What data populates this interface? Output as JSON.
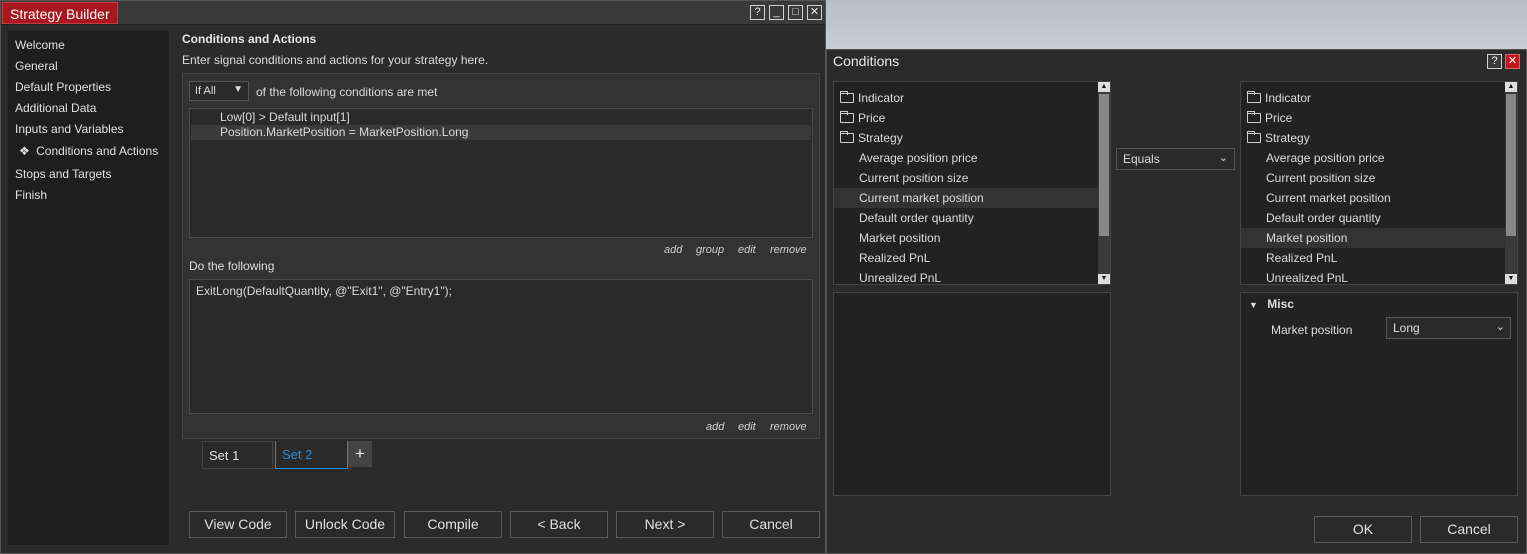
{
  "strategy_builder": {
    "title": "Strategy Builder",
    "window_buttons": [
      "?",
      "_",
      "□",
      "✕"
    ],
    "nav": [
      {
        "label": "Welcome",
        "active": false
      },
      {
        "label": "General",
        "active": false
      },
      {
        "label": "Default Properties",
        "active": false
      },
      {
        "label": "Additional Data",
        "active": false
      },
      {
        "label": "Inputs and Variables",
        "active": false
      },
      {
        "label": "Conditions and Actions",
        "active": true
      },
      {
        "label": "Stops and Targets",
        "active": false
      },
      {
        "label": "Finish",
        "active": false
      }
    ],
    "active_marker": "❖",
    "header": "Conditions and Actions",
    "description": "Enter signal conditions and actions for your strategy here.",
    "conditions": {
      "match_select": "If All",
      "match_label": "of the following conditions are met",
      "rows": [
        "Low[0] > Default input[1]",
        "Position.MarketPosition = MarketPosition.Long"
      ],
      "links": [
        "add",
        "group",
        "edit",
        "remove"
      ]
    },
    "actions": {
      "label": "Do the following",
      "code": "ExitLong(DefaultQuantity, @\"Exit1\", @\"Entry1\");",
      "links": [
        "add",
        "edit",
        "remove"
      ]
    },
    "sets": [
      {
        "label": "Set 1",
        "active": false
      },
      {
        "label": "Set 2",
        "active": true
      }
    ],
    "add_set": "+",
    "footer_buttons": [
      "View Code",
      "Unlock Code",
      "Compile",
      "< Back",
      "Next >",
      "Cancel"
    ]
  },
  "conditions_dialog": {
    "title": "Conditions",
    "title_buttons": [
      "?",
      "✕"
    ],
    "left_tree": {
      "folders": [
        "Indicator",
        "Price",
        "Strategy"
      ],
      "items": [
        "Average position price",
        "Current position size",
        "Current market position",
        "Default order quantity",
        "Market position",
        "Realized PnL",
        "Unrealized PnL"
      ],
      "selected_item": "Current market position"
    },
    "operator": "Equals",
    "right_tree": {
      "folders": [
        "Indicator",
        "Price",
        "Strategy"
      ],
      "items": [
        "Average position price",
        "Current position size",
        "Current market position",
        "Default order quantity",
        "Market position",
        "Realized PnL",
        "Unrealized PnL"
      ],
      "selected_item": "Market position"
    },
    "properties": {
      "group": "Misc",
      "expand_icon": "▼",
      "property_label": "Market position",
      "property_value": "Long"
    },
    "buttons": [
      "OK",
      "Cancel"
    ],
    "colors": {
      "close_button": "#c0171f",
      "accent": "#a8161f",
      "link_blue": "#2d8ad8"
    }
  }
}
